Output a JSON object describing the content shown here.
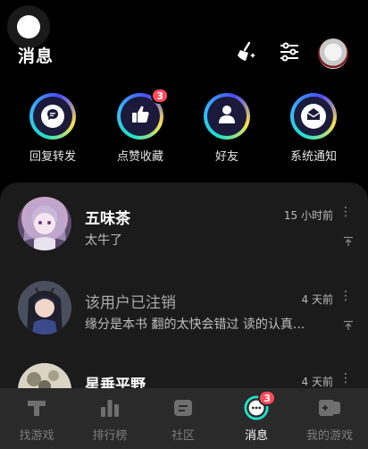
{
  "header": {
    "title": "消息"
  },
  "categories": [
    {
      "label": "回复转发",
      "icon": "comment-icon"
    },
    {
      "label": "点赞收藏",
      "icon": "thumbs-up-icon",
      "badge": "3"
    },
    {
      "label": "好友",
      "icon": "person-icon"
    },
    {
      "label": "系统通知",
      "icon": "envelope-icon"
    }
  ],
  "messages": [
    {
      "name": "五味茶",
      "text": "太牛了",
      "time": "15 小时前"
    },
    {
      "name": "该用户已注销",
      "text": "缘分是本书 翻的太快会错过 读的认真...",
      "time": "4 天前"
    },
    {
      "name": "星垂平野",
      "text": "",
      "time": "4 天前"
    }
  ],
  "tabbar": [
    {
      "label": "找游戏",
      "icon": "game-t-icon"
    },
    {
      "label": "排行榜",
      "icon": "ranking-icon"
    },
    {
      "label": "社区",
      "icon": "community-icon"
    },
    {
      "label": "消息",
      "icon": "message-icon",
      "badge": "3",
      "active": true
    },
    {
      "label": "我的游戏",
      "icon": "my-games-icon"
    }
  ],
  "colors": {
    "accent": "#20e3c9",
    "badge": "#ff4b5b",
    "panel": "#1b1b1b",
    "tabbar": "#2a2a2a"
  }
}
